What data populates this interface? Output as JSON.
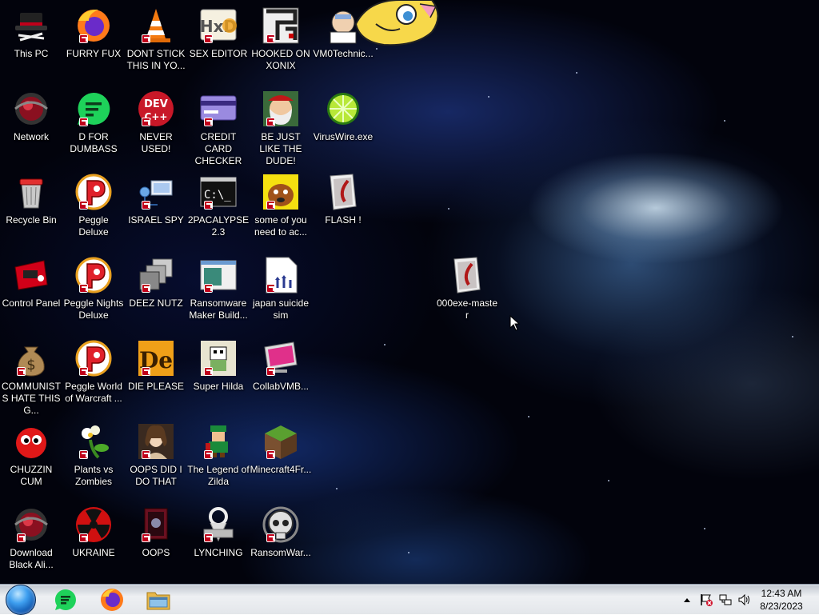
{
  "desktop": {
    "icons": [
      {
        "id": "this-pc",
        "label": "This PC",
        "icon": "hat-icon",
        "shortcut": false
      },
      {
        "id": "network",
        "label": "Network",
        "icon": "red-orb-icon",
        "shortcut": false
      },
      {
        "id": "recycle-bin",
        "label": "Recycle Bin",
        "icon": "recycle-bin-icon",
        "shortcut": false
      },
      {
        "id": "control-panel",
        "label": "Control Panel",
        "icon": "control-panel-icon",
        "shortcut": false
      },
      {
        "id": "communists",
        "label": "COMMUNISTS HATE THIS G...",
        "icon": "money-bag-icon",
        "shortcut": true
      },
      {
        "id": "chuzzin",
        "label": "CHUZZIN CUM",
        "icon": "chuzzle-icon",
        "shortcut": false
      },
      {
        "id": "download-black",
        "label": "Download Black Ali...",
        "icon": "red-orb-icon",
        "shortcut": true
      },
      {
        "id": "furry-fux",
        "label": "FURRY FUX",
        "icon": "firefox-icon",
        "shortcut": true
      },
      {
        "id": "d-for-dumbass",
        "label": "D FOR DUMBASS",
        "icon": "chat-bubble-icon",
        "shortcut": true
      },
      {
        "id": "peggle-deluxe",
        "label": "Peggle Deluxe",
        "icon": "peggle-icon",
        "shortcut": true
      },
      {
        "id": "peggle-nights",
        "label": "Peggle Nights Deluxe",
        "icon": "peggle-icon",
        "shortcut": true
      },
      {
        "id": "peggle-world",
        "label": "Peggle World of Warcraft ...",
        "icon": "peggle-icon",
        "shortcut": true
      },
      {
        "id": "plants-vs-zombies",
        "label": "Plants vs Zombies",
        "icon": "flower-icon",
        "shortcut": true
      },
      {
        "id": "ukraine",
        "label": "UKRAINE",
        "icon": "radiation-icon",
        "shortcut": true
      },
      {
        "id": "dont-stick",
        "label": "DONT STICK THIS IN YO...",
        "icon": "traffic-cone-icon",
        "shortcut": true
      },
      {
        "id": "never-used",
        "label": "NEVER USED!",
        "icon": "devcpp-icon",
        "shortcut": true
      },
      {
        "id": "israel-spy",
        "label": "ISRAEL SPY",
        "icon": "network-computer-icon",
        "shortcut": true
      },
      {
        "id": "deez-nutz",
        "label": "DEEZ NUTZ",
        "icon": "stacked-windows-icon",
        "shortcut": true
      },
      {
        "id": "die-please",
        "label": "DIE PLEASE",
        "icon": "de-letters-icon",
        "shortcut": true
      },
      {
        "id": "oops-did-i",
        "label": "OOPS DID I DO THAT",
        "icon": "portrait-icon",
        "shortcut": true
      },
      {
        "id": "oops",
        "label": "OOPS",
        "icon": "book-icon",
        "shortcut": true
      },
      {
        "id": "sex-editor",
        "label": "SEX EDITOR",
        "icon": "hxd-icon",
        "shortcut": true
      },
      {
        "id": "credit-card",
        "label": "CREDIT CARD CHECKER",
        "icon": "credit-card-icon",
        "shortcut": true
      },
      {
        "id": "2pacalypse",
        "label": "2PACALYPSE 2.3",
        "icon": "terminal-icon",
        "shortcut": true
      },
      {
        "id": "ransomware-maker",
        "label": "Ransomware Maker Build...",
        "icon": "window-app-icon",
        "shortcut": true
      },
      {
        "id": "super-hilda",
        "label": "Super Hilda",
        "icon": "pixel-character-icon",
        "shortcut": true
      },
      {
        "id": "legend-of-zilda",
        "label": "The Legend of Zilda",
        "icon": "pixel-hero-icon",
        "shortcut": true
      },
      {
        "id": "lynching",
        "label": "LYNCHING",
        "icon": "zipper-icon",
        "shortcut": true
      },
      {
        "id": "hooked-on-xonix",
        "label": "HOOKED ON XONIX",
        "icon": "maze-icon",
        "shortcut": true
      },
      {
        "id": "be-just-like",
        "label": "BE JUST LIKE THE DUDE!",
        "icon": "elf-face-icon",
        "shortcut": true
      },
      {
        "id": "some-of-you",
        "label": "some of you need to ac...",
        "icon": "dog-icon",
        "shortcut": true
      },
      {
        "id": "japan-suicide",
        "label": "japan suicide sim",
        "icon": "document-icon",
        "shortcut": true
      },
      {
        "id": "collabvmb",
        "label": "CollabVMB...",
        "icon": "monitor-icon",
        "shortcut": true
      },
      {
        "id": "minecraft",
        "label": "Minecraft4Fr...",
        "icon": "grass-block-icon",
        "shortcut": true
      },
      {
        "id": "ransomwar",
        "label": "RansomWar...",
        "icon": "skull-icon",
        "shortcut": true
      },
      {
        "id": "vm0technic",
        "label": "VM0Technic...",
        "icon": "doctor-icon",
        "shortcut": false
      },
      {
        "id": "viruswire",
        "label": "VirusWire.exe",
        "icon": "lime-icon",
        "shortcut": false
      },
      {
        "id": "flash",
        "label": "FLASH !",
        "icon": "flash-icon",
        "shortcut": false
      },
      {
        "id": "000exe-master",
        "label": "000exe-maste r",
        "icon": "flash-icon",
        "shortcut": false
      }
    ]
  },
  "taskbar": {
    "pinned": [
      {
        "id": "start",
        "icon": "start-orb-icon"
      },
      {
        "id": "chat",
        "icon": "chat-bubble-icon"
      },
      {
        "id": "firefox",
        "icon": "firefox-icon"
      },
      {
        "id": "explorer",
        "icon": "folder-icon"
      }
    ],
    "tray": {
      "icons": [
        "chevron-up-icon",
        "action-center-flag-icon",
        "network-icon",
        "speaker-icon"
      ]
    },
    "clock": {
      "time": "12:43 AM",
      "date": "8/23/2023"
    }
  },
  "colors": {
    "taskbar_bg": "#e3e6ea",
    "start_orb": "#3fa0f0",
    "shortcut_badge": "#c0001a",
    "label_text": "#ffffff"
  }
}
